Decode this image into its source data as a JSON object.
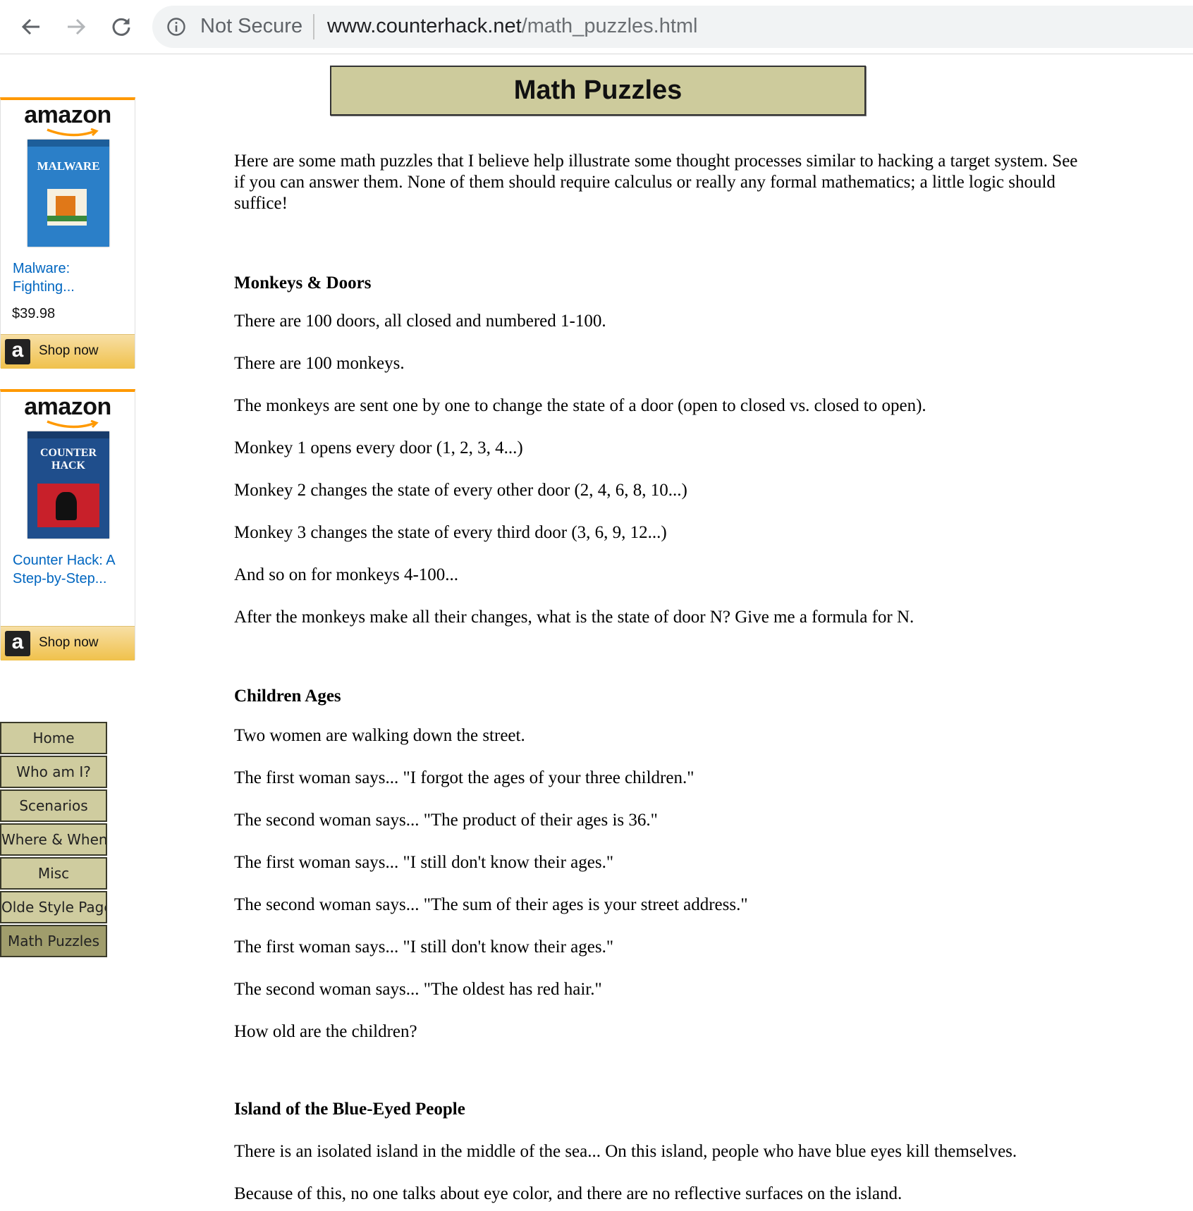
{
  "browser": {
    "security_label": "Not Secure",
    "url_host": "www.counterhack.net",
    "url_path": "/math_puzzles.html"
  },
  "ads": [
    {
      "logo": "amazon",
      "book_title": "MALWARE",
      "title": "Malware: Fighting...",
      "title_line1": "Malware:",
      "title_line2": "Fighting...",
      "price": "$39.98",
      "shop_label": "Shop now"
    },
    {
      "logo": "amazon",
      "book_title": "COUNTER HACK",
      "title_line1": "Counter Hack: A",
      "title_line2": "Step-by-Step...",
      "shop_label": "Shop now"
    }
  ],
  "nav": {
    "items": [
      {
        "label": "Home"
      },
      {
        "label": "Who am I?"
      },
      {
        "label": "Scenarios"
      },
      {
        "label": "Where & When"
      },
      {
        "label": "Misc"
      },
      {
        "label": "Olde Style Page"
      },
      {
        "label": "Math Puzzles"
      }
    ],
    "active": "Math Puzzles"
  },
  "page": {
    "title": "Math Puzzles",
    "intro": "Here are some math puzzles that I believe help illustrate some thought processes similar to hacking a target system. See if you can answer them.  None of them should require calculus or really any formal mathematics; a little logic should suffice!"
  },
  "puzzles": [
    {
      "heading": "Monkeys & Doors",
      "lines": [
        "There are 100 doors, all closed and numbered 1-100.",
        "There are 100 monkeys.",
        "The monkeys are sent one by one to change the state of a door (open to closed vs. closed to open).",
        "Monkey 1 opens every door (1, 2, 3, 4...)",
        "Monkey 2 changes the state of every other door (2, 4, 6, 8, 10...)",
        "Monkey 3 changes the state of every third door (3, 6, 9, 12...)",
        "And so on for monkeys 4-100...",
        "After the monkeys make all their changes, what is the state of door N?  Give me a formula for N."
      ]
    },
    {
      "heading": "Children Ages",
      "lines": [
        "Two women are walking down the street.",
        "The first woman says... \"I forgot the ages of your three children.\"",
        "The second woman says... \"The product of their ages is 36.\"",
        "The first woman says... \"I still don't know their ages.\"",
        "The second woman says... \"The sum of their ages is your street address.\"",
        "The first woman says... \"I still don't know their ages.\"",
        "The second woman says... \"The oldest has red hair.\"",
        "How old are the children?"
      ]
    },
    {
      "heading": "Island of the Blue-Eyed People",
      "lines": [
        "There is an isolated island in the middle of the sea... On this island, people who have blue eyes kill themselves.",
        "Because of this, no one talks about eye color, and there are no reflective surfaces on the island."
      ]
    }
  ]
}
